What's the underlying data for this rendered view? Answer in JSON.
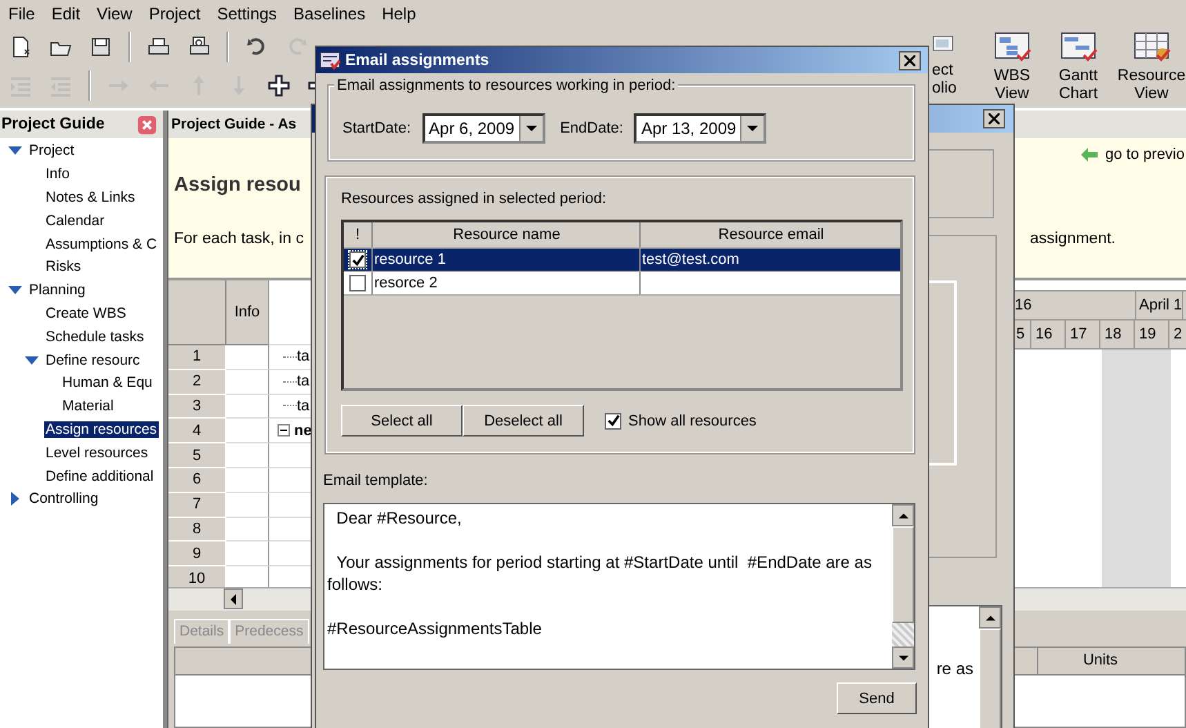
{
  "menu": [
    "File",
    "Edit",
    "View",
    "Project",
    "Settings",
    "Baselines",
    "Help"
  ],
  "toolbar": {
    "row_1": [
      {
        "kind": "new",
        "disabled": false
      },
      {
        "kind": "open",
        "disabled": false
      },
      {
        "kind": "save",
        "disabled": false
      },
      {
        "kind": "print",
        "disabled": false
      },
      {
        "kind": "preview",
        "disabled": false
      },
      {
        "kind": "undo",
        "disabled": false
      },
      {
        "kind": "redo",
        "disabled": true
      }
    ],
    "row_2": [
      {
        "kind": "indent",
        "disabled": true
      },
      {
        "kind": "outdent",
        "disabled": true
      },
      {
        "kind": "right",
        "disabled": true
      },
      {
        "kind": "left",
        "disabled": true
      },
      {
        "kind": "up",
        "disabled": true
      },
      {
        "kind": "down",
        "disabled": true
      },
      {
        "kind": "plus",
        "disabled": false
      },
      {
        "kind": "minus",
        "disabled": false
      }
    ],
    "view_buttons": [
      {
        "kind": "portfolio",
        "lines": [
          "ect",
          "olio"
        ]
      },
      {
        "kind": "wbs",
        "lines": [
          "WBS",
          "View"
        ]
      },
      {
        "kind": "gantt",
        "lines": [
          "Gantt",
          "Chart"
        ]
      },
      {
        "kind": "resource",
        "lines": [
          "Resource",
          "View"
        ]
      }
    ]
  },
  "project_guide": {
    "title": "Project Guide",
    "tree": [
      {
        "label": "Project",
        "expanded": true,
        "selected": false,
        "children": [
          {
            "label": "Info",
            "selected": false
          },
          {
            "label": "Notes & Links",
            "selected": false
          },
          {
            "label": "Calendar",
            "selected": false
          },
          {
            "label": "Assumptions & C",
            "selected": false
          },
          {
            "label": "Risks",
            "selected": false
          }
        ]
      },
      {
        "label": "Planning",
        "expanded": true,
        "selected": false,
        "children": [
          {
            "label": "Create WBS",
            "selected": false
          },
          {
            "label": "Schedule tasks",
            "selected": false
          },
          {
            "label": "Define resourc",
            "expanded": true,
            "selected": false,
            "children": [
              {
                "label": "Human & Equ",
                "selected": false
              },
              {
                "label": "Material",
                "selected": false
              }
            ]
          },
          {
            "label": "Assign resources",
            "selected": true
          },
          {
            "label": "Level resources",
            "selected": false
          },
          {
            "label": "Define additional",
            "selected": false
          }
        ]
      },
      {
        "label": "Controlling",
        "expanded": false,
        "selected": false
      }
    ]
  },
  "guide_panel": {
    "title": "Project Guide - As",
    "heading": "Assign resou",
    "link": "go to previo",
    "text_left": "For each task, in c",
    "text_right": "assignment."
  },
  "task_grid": {
    "columns": [
      "Info"
    ],
    "rows": [
      {
        "number": "1",
        "task": "ta",
        "kind": "task"
      },
      {
        "number": "2",
        "task": "ta",
        "kind": "task"
      },
      {
        "number": "3",
        "task": "ta",
        "kind": "task"
      },
      {
        "number": "4",
        "task": "ne",
        "kind": "summary"
      },
      {
        "number": "5",
        "kind": "empty"
      },
      {
        "number": "6",
        "kind": "empty"
      },
      {
        "number": "7",
        "kind": "empty"
      },
      {
        "number": "8",
        "kind": "empty"
      },
      {
        "number": "9",
        "kind": "empty"
      },
      {
        "number": "10",
        "kind": "empty"
      }
    ]
  },
  "gantt": {
    "weeks": [
      "16",
      "April 1"
    ],
    "days": [
      {
        "label": "5",
        "weekend": false
      },
      {
        "label": "16",
        "weekend": false
      },
      {
        "label": "17",
        "weekend": false
      },
      {
        "label": "18",
        "weekend": true
      },
      {
        "label": "19",
        "weekend": true
      },
      {
        "label": "2",
        "weekend": false
      }
    ]
  },
  "bottom_tabs": [
    {
      "label": "Details",
      "disabled": true
    },
    {
      "label": "Predecess",
      "disabled": true
    }
  ],
  "bottom_table": {
    "columns": [
      "Units"
    ]
  },
  "back_dialog": {
    "template_fragment": "re as"
  },
  "dialog": {
    "title": "Email assignments",
    "period_legend": "Email assignments to resources working in period:",
    "start_label": "StartDate:",
    "start_value": "Apr 6, 2009",
    "end_label": "EndDate:",
    "end_value": "Apr 13, 2009",
    "resources_label": "Resources assigned in selected period:",
    "columns": [
      "!",
      "Resource name",
      "Resource email"
    ],
    "rows": [
      {
        "name": "resource 1",
        "email": "test@test.com",
        "checked": true,
        "selected": true
      },
      {
        "name": "resorce 2",
        "checked": false,
        "selected": false
      }
    ],
    "buttons": [
      "Select all",
      "Deselect all"
    ],
    "show_all": {
      "label": "Show all resources",
      "checked": true
    },
    "template_label": "Email template:",
    "template": [
      "  Dear #Resource,",
      "  Your assignments for period starting at #StartDate until  #EndDate are as follows:",
      "#ResourceAssignmentsTable"
    ],
    "send": "Send"
  }
}
